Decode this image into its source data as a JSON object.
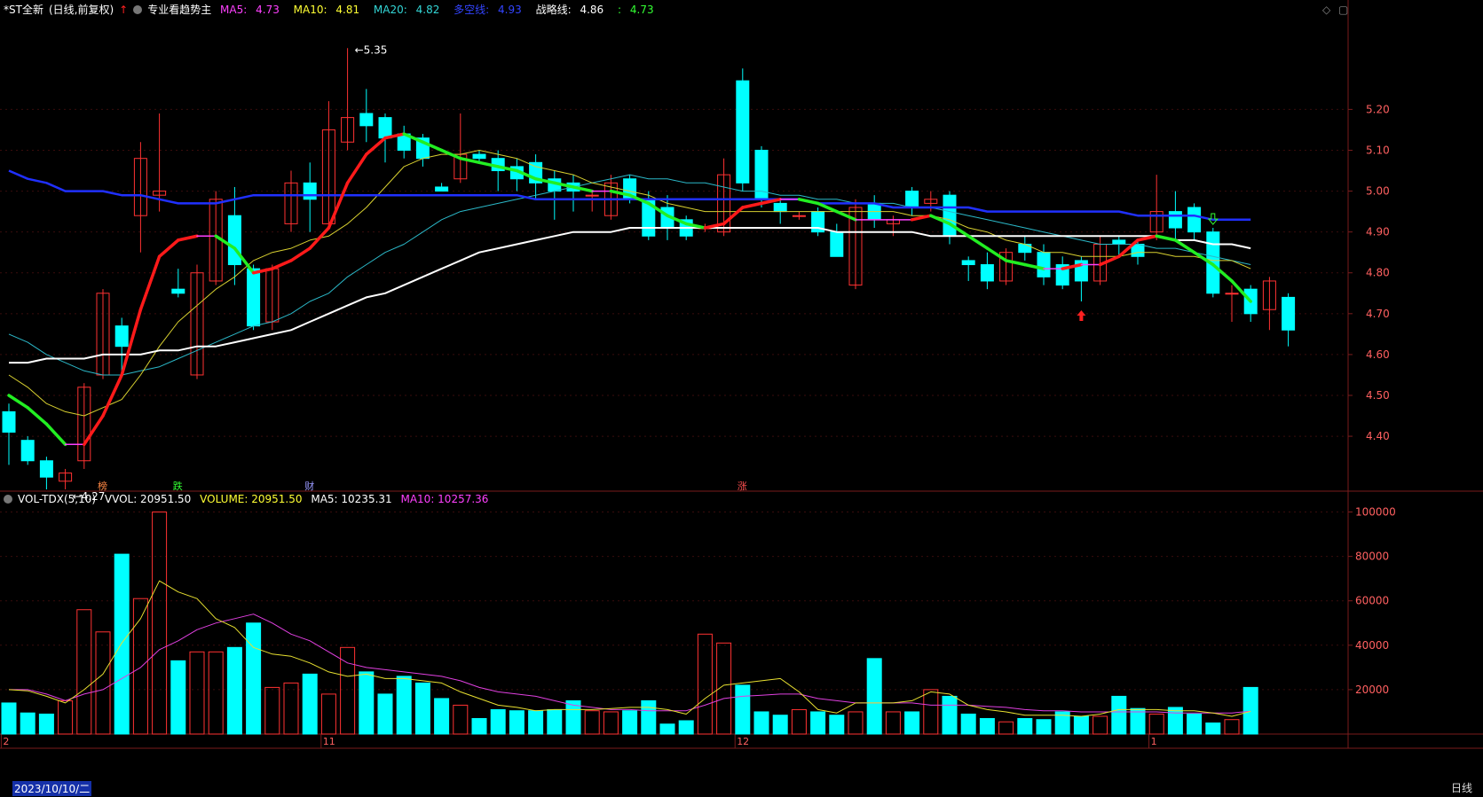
{
  "window": {
    "corner_icons": [
      "◇",
      "▢"
    ]
  },
  "kline_header": {
    "stock": "*ST全新",
    "mode": "(日线,前复权)",
    "indicator": "专业看趋势主",
    "ma5": {
      "label": "MA5:",
      "value": "4.73",
      "color": "#ff40ff"
    },
    "ma10": {
      "label": "MA10:",
      "value": "4.81",
      "color": "#ffff33"
    },
    "ma20": {
      "label": "MA20:",
      "value": "4.82",
      "color": "#33d6d6"
    },
    "dkx": {
      "label": "多空线:",
      "value": "4.93",
      "color": "#3344ff"
    },
    "zlx": {
      "label": "战略线:",
      "value": "4.86",
      "color": "#ffffff"
    },
    "last": {
      "label": ":",
      "value": "4.73",
      "color": "#33ff33"
    }
  },
  "vol_header": {
    "title": "VOL-TDX(5,10)",
    "vvol": "VVOL: 20951.50",
    "volume": "VOLUME: 20951.50",
    "ma5": "MA5: 10235.31",
    "ma10": "MA10: 10257.36"
  },
  "footer": {
    "date_label": "2023/10/10/二",
    "period": "日线"
  },
  "colors": {
    "up": "#ff3232",
    "down": "#00ffff",
    "axis": "#7a1d1d",
    "text": "#ff6060"
  },
  "chart_data": {
    "type": "candlestick",
    "dates_start": "2023/10/10",
    "x_axis_ticks": [
      {
        "index": 0,
        "label": "2"
      },
      {
        "index": 17,
        "label": "11"
      },
      {
        "index": 39,
        "label": "12"
      },
      {
        "index": 61,
        "label": "1"
      }
    ],
    "price_axis": {
      "ylim": [
        4.27,
        5.42
      ],
      "ticks": [
        4.4,
        4.5,
        4.6,
        4.7,
        4.8,
        4.9,
        5.0,
        5.1,
        5.2
      ]
    },
    "volume_axis": {
      "ylim": [
        0,
        105000
      ],
      "ticks": [
        20000,
        40000,
        60000,
        80000,
        100000
      ]
    },
    "candles": [
      [
        4.46,
        4.41,
        4.48,
        4.33
      ],
      [
        4.39,
        4.34,
        4.4,
        4.33
      ],
      [
        4.34,
        4.3,
        4.35,
        4.27
      ],
      [
        4.29,
        4.31,
        4.32,
        4.27
      ],
      [
        4.34,
        4.52,
        4.53,
        4.32
      ],
      [
        4.55,
        4.75,
        4.76,
        4.54
      ],
      [
        4.67,
        4.62,
        4.69,
        4.55
      ],
      [
        4.94,
        5.08,
        5.12,
        4.85
      ],
      [
        4.99,
        5.0,
        5.19,
        4.95
      ],
      [
        4.76,
        4.75,
        4.81,
        4.74
      ],
      [
        4.55,
        4.8,
        4.82,
        4.54
      ],
      [
        4.78,
        4.98,
        5.0,
        4.77
      ],
      [
        4.94,
        4.82,
        5.01,
        4.77
      ],
      [
        4.81,
        4.67,
        4.82,
        4.66
      ],
      [
        4.68,
        4.81,
        4.82,
        4.66
      ],
      [
        4.92,
        5.02,
        5.05,
        4.9
      ],
      [
        5.02,
        4.98,
        5.07,
        4.9
      ],
      [
        4.92,
        5.15,
        5.22,
        4.91
      ],
      [
        5.12,
        5.18,
        5.35,
        5.1
      ],
      [
        5.19,
        5.16,
        5.25,
        5.12
      ],
      [
        5.18,
        5.13,
        5.19,
        5.07
      ],
      [
        5.14,
        5.1,
        5.16,
        5.08
      ],
      [
        5.13,
        5.08,
        5.14,
        5.06
      ],
      [
        5.01,
        5.0,
        5.02,
        5.0
      ],
      [
        5.03,
        5.09,
        5.19,
        5.02
      ],
      [
        5.09,
        5.08,
        5.1,
        5.07
      ],
      [
        5.08,
        5.05,
        5.1,
        5.0
      ],
      [
        5.06,
        5.03,
        5.08,
        5.0
      ],
      [
        5.07,
        5.02,
        5.09,
        4.98
      ],
      [
        5.03,
        5.0,
        5.05,
        4.93
      ],
      [
        5.02,
        5.0,
        5.04,
        4.95
      ],
      [
        4.99,
        4.99,
        5.0,
        4.95
      ],
      [
        4.94,
        5.02,
        5.04,
        4.93
      ],
      [
        5.03,
        4.98,
        5.04,
        4.97
      ],
      [
        4.98,
        4.89,
        5.0,
        4.88
      ],
      [
        4.96,
        4.91,
        4.99,
        4.88
      ],
      [
        4.93,
        4.89,
        4.94,
        4.88
      ],
      [
        4.91,
        4.91,
        4.92,
        4.9
      ],
      [
        4.9,
        5.04,
        5.08,
        4.89
      ],
      [
        5.27,
        5.02,
        5.3,
        5.0
      ],
      [
        5.1,
        4.98,
        5.11,
        4.96
      ],
      [
        4.97,
        4.95,
        4.98,
        4.92
      ],
      [
        4.94,
        4.94,
        4.95,
        4.93
      ],
      [
        4.95,
        4.9,
        4.96,
        4.89
      ],
      [
        4.9,
        4.84,
        4.92,
        4.84
      ],
      [
        4.77,
        4.96,
        4.98,
        4.76
      ],
      [
        4.97,
        4.93,
        4.99,
        4.91
      ],
      [
        4.92,
        4.93,
        4.94,
        4.89
      ],
      [
        5.0,
        4.96,
        5.01,
        4.94
      ],
      [
        4.97,
        4.98,
        5.0,
        4.95
      ],
      [
        4.99,
        4.89,
        5.0,
        4.87
      ],
      [
        4.83,
        4.82,
        4.84,
        4.78
      ],
      [
        4.82,
        4.78,
        4.85,
        4.76
      ],
      [
        4.78,
        4.85,
        4.86,
        4.77
      ],
      [
        4.87,
        4.85,
        4.89,
        4.83
      ],
      [
        4.85,
        4.79,
        4.87,
        4.77
      ],
      [
        4.82,
        4.77,
        4.84,
        4.76
      ],
      [
        4.83,
        4.78,
        4.84,
        4.73
      ],
      [
        4.78,
        4.87,
        4.89,
        4.77
      ],
      [
        4.88,
        4.87,
        4.89,
        4.84
      ],
      [
        4.87,
        4.84,
        4.88,
        4.82
      ],
      [
        4.9,
        4.95,
        5.04,
        4.88
      ],
      [
        4.95,
        4.91,
        5.0,
        4.88
      ],
      [
        4.96,
        4.9,
        4.97,
        4.88
      ],
      [
        4.9,
        4.75,
        4.91,
        4.74
      ],
      [
        4.75,
        4.75,
        4.77,
        4.68
      ],
      [
        4.76,
        4.7,
        4.77,
        4.68
      ],
      [
        4.71,
        4.78,
        4.79,
        4.66
      ],
      [
        4.74,
        4.66,
        4.75,
        4.62
      ]
    ],
    "volume": [
      14000,
      9500,
      9000,
      15000,
      56000,
      46000,
      81000,
      61000,
      100000,
      33000,
      37000,
      37000,
      39000,
      50000,
      21000,
      23000,
      27000,
      18000,
      39000,
      28000,
      18000,
      26000,
      23000,
      16000,
      13000,
      7000,
      11000,
      10500,
      10500,
      11000,
      15000,
      10500,
      10000,
      10500,
      15000,
      4500,
      6000,
      45000,
      41000,
      22000,
      10000,
      8500,
      11000,
      10000,
      8500,
      10000,
      34000,
      10000,
      10000,
      20000,
      17000,
      9000,
      7000,
      5500,
      7000,
      6500,
      10000,
      8000,
      8000,
      17000,
      11500,
      9000,
      12000,
      9000,
      5000,
      6500,
      21000
    ],
    "ma_lines": {
      "dkx_blue": [
        5.05,
        5.03,
        5.02,
        5.0,
        5.0,
        5.0,
        4.99,
        4.99,
        4.98,
        4.97,
        4.97,
        4.97,
        4.98,
        4.99,
        4.99,
        4.99,
        4.99,
        4.99,
        4.99,
        4.99,
        4.99,
        4.99,
        4.99,
        4.99,
        4.99,
        4.99,
        4.99,
        4.99,
        4.98,
        4.98,
        4.98,
        4.98,
        4.98,
        4.98,
        4.98,
        4.98,
        4.98,
        4.98,
        4.98,
        4.98,
        4.98,
        4.98,
        4.98,
        4.97,
        4.97,
        4.97,
        4.97,
        4.96,
        4.96,
        4.96,
        4.96,
        4.96,
        4.95,
        4.95,
        4.95,
        4.95,
        4.95,
        4.95,
        4.95,
        4.95,
        4.94,
        4.94,
        4.94,
        4.94,
        4.93,
        4.93,
        4.93
      ],
      "zlx_white": [
        4.58,
        4.58,
        4.59,
        4.59,
        4.59,
        4.6,
        4.6,
        4.6,
        4.61,
        4.61,
        4.62,
        4.62,
        4.63,
        4.64,
        4.65,
        4.66,
        4.68,
        4.7,
        4.72,
        4.74,
        4.75,
        4.77,
        4.79,
        4.81,
        4.83,
        4.85,
        4.86,
        4.87,
        4.88,
        4.89,
        4.9,
        4.9,
        4.9,
        4.91,
        4.91,
        4.91,
        4.91,
        4.91,
        4.91,
        4.91,
        4.91,
        4.91,
        4.91,
        4.91,
        4.9,
        4.9,
        4.9,
        4.9,
        4.9,
        4.89,
        4.89,
        4.89,
        4.89,
        4.89,
        4.89,
        4.89,
        4.89,
        4.89,
        4.89,
        4.89,
        4.89,
        4.89,
        4.88,
        4.88,
        4.87,
        4.87,
        4.86
      ],
      "ma5": [
        4.5,
        4.47,
        4.43,
        4.38,
        4.38,
        4.45,
        4.55,
        4.71,
        4.84,
        4.88,
        4.89,
        4.89,
        4.86,
        4.8,
        4.81,
        4.83,
        4.86,
        4.91,
        5.02,
        5.09,
        5.13,
        5.14,
        5.12,
        5.1,
        5.08,
        5.07,
        5.06,
        5.05,
        5.03,
        5.02,
        5.01,
        5.0,
        5.0,
        4.99,
        4.97,
        4.94,
        4.92,
        4.91,
        4.92,
        4.96,
        4.97,
        4.98,
        4.98,
        4.97,
        4.95,
        4.93,
        4.93,
        4.93,
        4.93,
        4.94,
        4.92,
        4.89,
        4.86,
        4.83,
        4.82,
        4.81,
        4.81,
        4.82,
        4.82,
        4.84,
        4.88,
        4.89,
        4.88,
        4.85,
        4.82,
        4.78,
        4.73
      ],
      "ma10": [
        4.55,
        4.52,
        4.48,
        4.46,
        4.45,
        4.47,
        4.49,
        4.55,
        4.62,
        4.68,
        4.72,
        4.76,
        4.79,
        4.83,
        4.85,
        4.86,
        4.88,
        4.89,
        4.92,
        4.96,
        5.01,
        5.06,
        5.08,
        5.09,
        5.09,
        5.1,
        5.09,
        5.08,
        5.06,
        5.05,
        5.04,
        5.02,
        5.01,
        5.0,
        4.99,
        4.97,
        4.96,
        4.95,
        4.95,
        4.95,
        4.95,
        4.95,
        4.95,
        4.95,
        4.95,
        4.95,
        4.95,
        4.95,
        4.94,
        4.94,
        4.93,
        4.91,
        4.9,
        4.88,
        4.87,
        4.85,
        4.85,
        4.84,
        4.84,
        4.84,
        4.85,
        4.85,
        4.84,
        4.84,
        4.83,
        4.83,
        4.81
      ],
      "ma20": [
        4.65,
        4.63,
        4.6,
        4.58,
        4.56,
        4.55,
        4.55,
        4.56,
        4.57,
        4.59,
        4.61,
        4.63,
        4.65,
        4.67,
        4.68,
        4.7,
        4.73,
        4.75,
        4.79,
        4.82,
        4.85,
        4.87,
        4.9,
        4.93,
        4.95,
        4.96,
        4.97,
        4.98,
        4.99,
        5.0,
        5.01,
        5.02,
        5.03,
        5.04,
        5.03,
        5.03,
        5.02,
        5.02,
        5.01,
        5.0,
        5.0,
        4.99,
        4.99,
        4.98,
        4.98,
        4.97,
        4.97,
        4.97,
        4.96,
        4.96,
        4.95,
        4.94,
        4.93,
        4.92,
        4.91,
        4.9,
        4.89,
        4.88,
        4.87,
        4.87,
        4.87,
        4.86,
        4.86,
        4.85,
        4.84,
        4.83,
        4.82
      ]
    },
    "vol_ma5": [
      20000,
      19500,
      17000,
      14000,
      20000,
      27000,
      41000,
      52000,
      69000,
      64000,
      61000,
      52000,
      48000,
      39000,
      36000,
      35000,
      32000,
      28000,
      26000,
      27000,
      25000,
      25000,
      24000,
      23000,
      19000,
      16000,
      13000,
      12000,
      10500,
      11000,
      11000,
      11000,
      11500,
      12000,
      12000,
      11000,
      9000,
      16000,
      22000,
      23000,
      24000,
      25000,
      19000,
      11000,
      9500,
      14000,
      14000,
      14000,
      15000,
      19000,
      18000,
      13000,
      11000,
      10000,
      8500,
      8500,
      8500,
      8000,
      9000,
      11000,
      11000,
      11000,
      10500,
      10500,
      9500,
      8000,
      10235
    ],
    "vol_ma10": [
      20000,
      20000,
      18000,
      15000,
      18000,
      20000,
      25000,
      30000,
      38000,
      42000,
      47000,
      50000,
      52000,
      54000,
      50000,
      45000,
      42000,
      37000,
      32000,
      30000,
      29000,
      28000,
      27000,
      26000,
      24000,
      21000,
      19000,
      18000,
      17000,
      15000,
      13000,
      12000,
      11000,
      11000,
      10500,
      10500,
      10500,
      13000,
      16000,
      17000,
      17500,
      18000,
      18000,
      16000,
      15000,
      14000,
      14000,
      14000,
      14000,
      13000,
      13000,
      13000,
      12500,
      12000,
      11000,
      10500,
      10500,
      10000,
      10000,
      10000,
      10000,
      10000,
      9500,
      9500,
      9500,
      9500,
      10257
    ],
    "annotations": [
      {
        "text": "5.35",
        "index": 18,
        "kind": "high"
      },
      {
        "text": "4.27",
        "index": 3,
        "kind": "low"
      }
    ],
    "event_tags": [
      {
        "text": "榜",
        "index": 5,
        "color": "#ff8844"
      },
      {
        "text": "跌",
        "index": 9,
        "color": "#33ff33"
      },
      {
        "text": "财",
        "index": 16,
        "color": "#9999ff"
      },
      {
        "text": "涨",
        "index": 39,
        "color": "#ff5050"
      }
    ],
    "signal_arrows": [
      {
        "index": 57,
        "dir": "up",
        "color": "#ff2020"
      },
      {
        "index": 64,
        "dir": "down",
        "color": "#33ff33"
      }
    ]
  }
}
